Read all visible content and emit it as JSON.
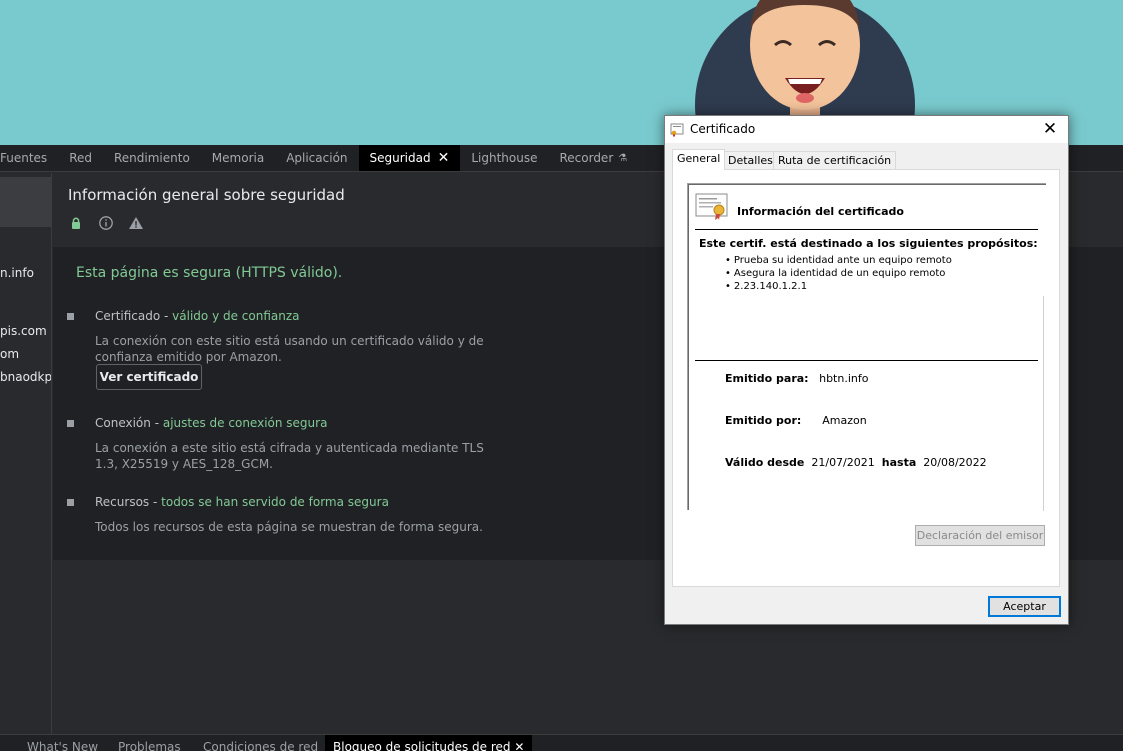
{
  "devtools": {
    "tabs": [
      {
        "label": "Fuentes"
      },
      {
        "label": "Red"
      },
      {
        "label": "Rendimiento"
      },
      {
        "label": "Memoria"
      },
      {
        "label": "Aplicación"
      },
      {
        "label": "Seguridad",
        "active": true
      },
      {
        "label": "Lighthouse"
      },
      {
        "label": "Recorder"
      }
    ],
    "origins": [
      "n.info",
      "pis.com",
      "om",
      "bnaodkpf"
    ],
    "bottom_tabs": [
      {
        "label": "What's New"
      },
      {
        "label": "Problemas"
      },
      {
        "label": "Condiciones de red"
      },
      {
        "label": "Bloqueo de solicitudes de red",
        "active": true
      }
    ]
  },
  "security": {
    "title": "Información general sobre seguridad",
    "secure_message": "Esta página es segura (HTTPS válido).",
    "items": [
      {
        "label": "Certificado",
        "status": "válido y de confianza",
        "description": "La conexión con este sitio está usando un certificado válido y de confianza emitido por Amazon.",
        "button": "Ver certificado"
      },
      {
        "label": "Conexión",
        "status": "ajustes de conexión segura",
        "description": "La conexión a este sitio está cifrada y autenticada mediante TLS 1.3, X25519 y AES_128_GCM."
      },
      {
        "label": "Recursos",
        "status": "todos se han servido de forma segura",
        "description": "Todos los recursos de esta página se muestran de forma segura."
      }
    ],
    "separator": " - "
  },
  "certificate_dialog": {
    "title": "Certificado",
    "tabs": [
      "General",
      "Detalles",
      "Ruta de certificación"
    ],
    "info_title": "Información del certificado",
    "purposes_heading": "Este certif. está destinado a los siguientes propósitos:",
    "purposes": [
      "Prueba su identidad ante un equipo remoto",
      "Asegura la identidad de un equipo remoto",
      "2.23.140.1.2.1"
    ],
    "issued_to_label": "Emitido para:",
    "issued_to": "hbtn.info",
    "issued_by_label": "Emitido por:",
    "issued_by": "Amazon",
    "valid_from_label": "Válido desde",
    "valid_from": "21/07/2021",
    "valid_to_label": "hasta",
    "valid_to": "20/08/2022",
    "issuer_statement_button": "Declaración del emisor",
    "ok_button": "Aceptar"
  },
  "colors": {
    "page_background": "#79cace",
    "devtools_dark": "#202124",
    "secure_green": "#81c995",
    "dialog_bg": "#f0f0f0",
    "focus_blue": "#0078d7"
  }
}
